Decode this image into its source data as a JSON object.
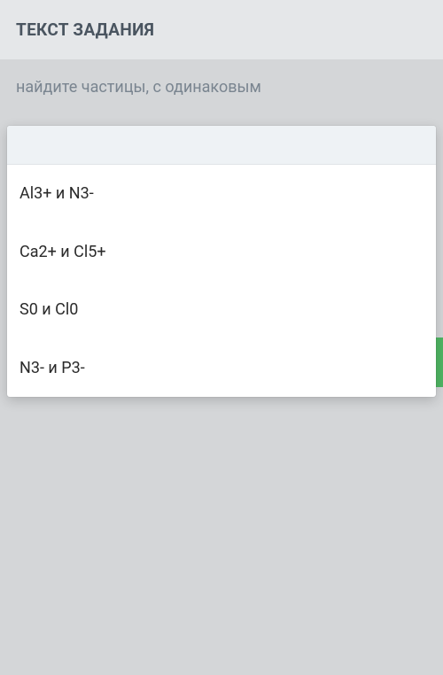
{
  "header": {
    "title": "ТЕКСТ ЗАДАНИЯ"
  },
  "question": {
    "text": "найдите частицы, с одинаковым"
  },
  "dropdown": {
    "options": [
      {
        "label": "Al3+ и N3-"
      },
      {
        "label": "Ca2+ и Cl5+"
      },
      {
        "label": "S0 и Cl0"
      },
      {
        "label": "N3- и P3-"
      }
    ]
  }
}
